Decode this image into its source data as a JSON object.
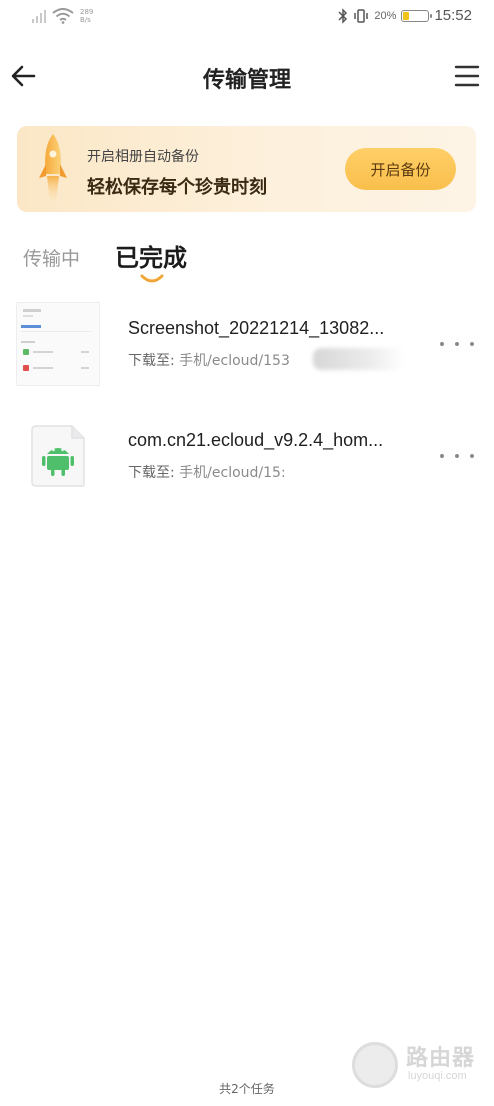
{
  "status_bar": {
    "net_speed_top": "289",
    "net_speed_bottom": "B/s",
    "battery_percent": "20%",
    "battery_level": 0.2,
    "time": "15:52"
  },
  "header": {
    "title": "传输管理",
    "back_icon": "arrow-left-icon",
    "menu_icon": "menu-lines-icon"
  },
  "banner": {
    "subtitle": "开启相册自动备份",
    "headline": "轻松保存每个珍贵时刻",
    "button_label": "开启备份",
    "accent": "#f9bf4c"
  },
  "tabs": {
    "transferring": "传输中",
    "completed": "已完成",
    "active": "completed",
    "indicator_color": "#f0a534"
  },
  "files": [
    {
      "name": "Screenshot_20221214_13082...",
      "path_label": "下载至:",
      "path_value": "手机/ecloud/153",
      "icon": "image-thumbnail"
    },
    {
      "name": "com.cn21.ecloud_v9.2.4_hom...",
      "path_label": "下载至:",
      "path_value": "手机/ecloud/15:",
      "icon": "android-apk-icon"
    }
  ],
  "footer": {
    "task_count": "共2个任务"
  },
  "watermark": {
    "cn": "路由器",
    "en": "luyouqi.com"
  }
}
